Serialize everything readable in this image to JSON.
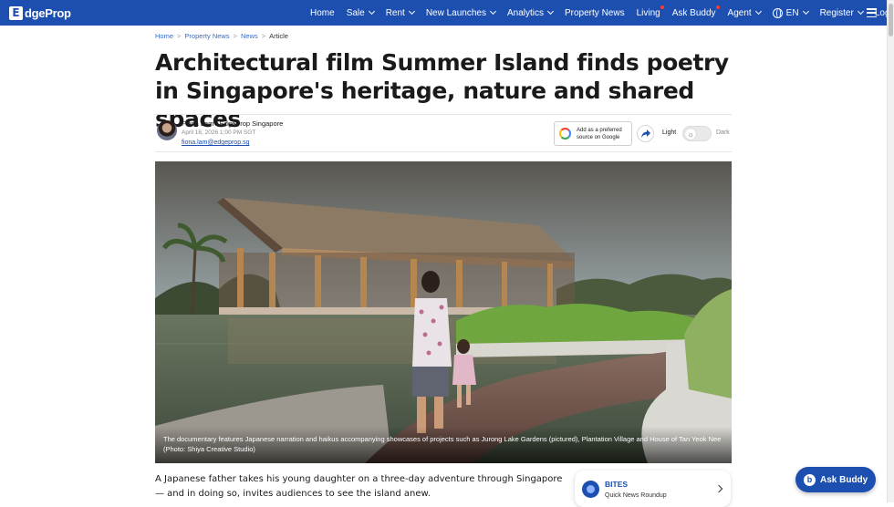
{
  "brand": {
    "logo_mark": "E",
    "logo_text": "dgeProp"
  },
  "nav": {
    "items": [
      {
        "label": "Home",
        "has_chevron": false
      },
      {
        "label": "Sale",
        "has_chevron": true
      },
      {
        "label": "Rent",
        "has_chevron": true
      },
      {
        "label": "New Launches",
        "has_chevron": true
      },
      {
        "label": "Analytics",
        "has_chevron": true
      },
      {
        "label": "Property News",
        "has_chevron": false
      },
      {
        "label": "Living",
        "has_chevron": false,
        "badge_dot": true
      },
      {
        "label": "Ask Buddy",
        "has_chevron": false,
        "badge_dot": true
      },
      {
        "label": "Agent",
        "has_chevron": true
      }
    ],
    "language": "EN",
    "register": "Register",
    "login": "Login",
    "menu_icon": "hamburger-icon"
  },
  "breadcrumb": {
    "home": "Home",
    "property_news": "Property News",
    "news": "News",
    "current": "Article",
    "separator": ">"
  },
  "article": {
    "title": "Architectural film Summer Island finds poetry in Singapore's heritage, nature and shared spaces",
    "author": "Fiona Lam / EdgeProp Singapore",
    "date": "April 16, 2026 1:00 PM SGT",
    "email": "fiona.lam@edgeprop.sg",
    "image_caption": "The documentary features Japanese narration and haikus accompanying showcases of projects such as Jurong Lake Gardens (pictured), Plantation Village and House of Tan Yeok Nee (Photo: Shiya Creative Studio)",
    "body_paragraph": "A Japanese father takes his young daughter on a three-day adventure through Singapore — and in doing so, invites audiences to see the island anew."
  },
  "actions": {
    "google_line1": "Add as a preferred",
    "google_line2": "source on Google",
    "share_icon": "share-arrow-icon",
    "theme_light": "Light",
    "theme_dark": "Dark",
    "theme_icon": "sun-icon"
  },
  "bites": {
    "title": "BITES",
    "subtitle": "Quick News Roundup"
  },
  "ask_buddy_button": {
    "icon_letter": "b",
    "label": "Ask Buddy"
  },
  "colors": {
    "brand_blue": "#1c4fb0",
    "badge_red": "#ff3b30",
    "link_blue": "#3a6bc2"
  }
}
